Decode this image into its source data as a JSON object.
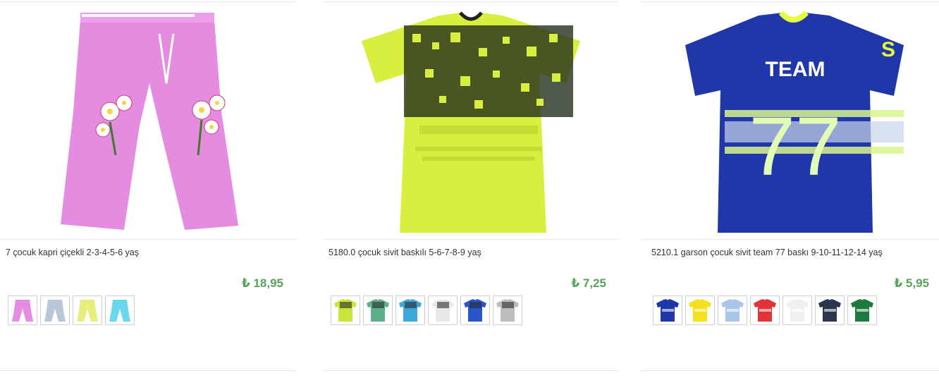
{
  "currency_symbol": "₺",
  "products": [
    {
      "title": "7 çocuk kapri çiçekli 2-3-4-5-6 yaş",
      "price": "₺ 18,95",
      "image_icon": "pink-capri-pants-image",
      "main_color": "#e38ce0",
      "swatches": [
        {
          "icon": "pink-capri-swatch",
          "color": "#e58ce3"
        },
        {
          "icon": "grey-capri-swatch",
          "color": "#b7c7d6"
        },
        {
          "icon": "yellow-capri-swatch",
          "color": "#e8ee7a"
        },
        {
          "icon": "turquoise-capri-swatch",
          "color": "#67d9ea"
        }
      ]
    },
    {
      "title": "5180.0 çocuk sivit baskılı 5-6-7-8-9 yaş",
      "price": "₺ 7,25",
      "image_icon": "lime-tshirt-image",
      "main_color": "#d9ef3f",
      "swatches": [
        {
          "icon": "lime-tshirt-swatch",
          "color": "#c9e43a"
        },
        {
          "icon": "green-tshirt-swatch",
          "color": "#5fb08a"
        },
        {
          "icon": "blue-tshirt-swatch",
          "color": "#3fa6d9"
        },
        {
          "icon": "white-tshirt-swatch",
          "color": "#e8e8e8"
        },
        {
          "icon": "royal-blue-tshirt-swatch",
          "color": "#2a55c9"
        },
        {
          "icon": "grey-tshirt-swatch",
          "color": "#bdbdbd"
        }
      ]
    },
    {
      "title": "5210.1 garson çocuk sivit team 77 baskı 9-10-11-12-14 yaş",
      "price": "₺ 5,95",
      "image_icon": "navy-team77-tshirt-image",
      "main_color": "#1f37a8",
      "swatches": [
        {
          "icon": "navy-team-swatch",
          "color": "#1f37a8"
        },
        {
          "icon": "yellow-team-swatch",
          "color": "#f3e21b"
        },
        {
          "icon": "light-blue-team-swatch",
          "color": "#a9c6e8"
        },
        {
          "icon": "red-team-swatch",
          "color": "#e2323a"
        },
        {
          "icon": "white-team-swatch",
          "color": "#f0f0f0"
        },
        {
          "icon": "dark-navy-team-swatch",
          "color": "#2b3550"
        },
        {
          "icon": "green-team-swatch",
          "color": "#1c7a3c"
        }
      ]
    }
  ]
}
